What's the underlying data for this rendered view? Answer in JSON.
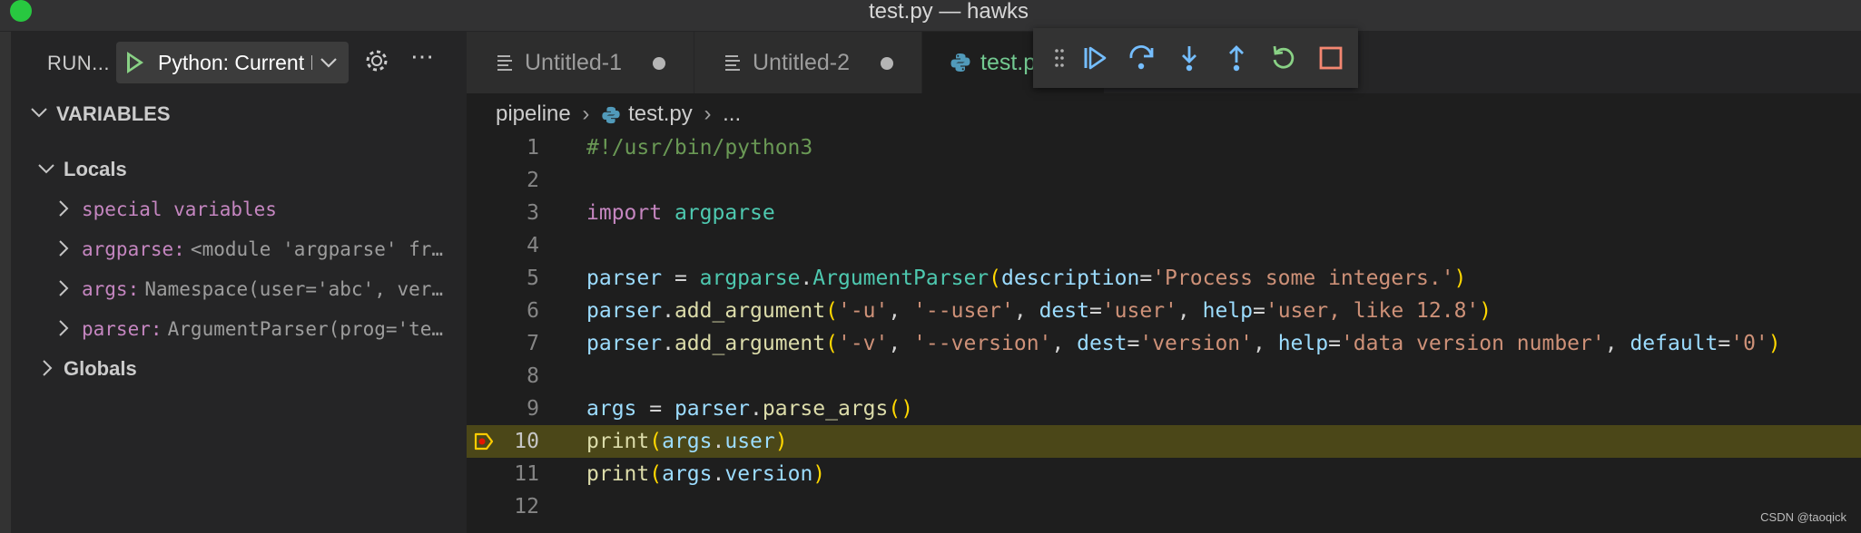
{
  "window": {
    "title": "test.py — hawks"
  },
  "sidebar": {
    "run_label": "RUN...",
    "config_name": "Python: Current File",
    "variables_title": "VARIABLES",
    "locals_label": "Locals",
    "globals_label": "Globals",
    "variables": [
      {
        "name": "special variables",
        "value": ""
      },
      {
        "name": "argparse:",
        "value": "<module 'argparse' fr…"
      },
      {
        "name": "args:",
        "value": "Namespace(user='abc', ver…"
      },
      {
        "name": "parser:",
        "value": "ArgumentParser(prog='te…"
      }
    ]
  },
  "tabs": [
    {
      "label": "Untitled-1",
      "dirty": true
    },
    {
      "label": "Untitled-2",
      "dirty": true
    },
    {
      "label": "test.py",
      "active": true
    }
  ],
  "breadcrumb": {
    "folder": "pipeline",
    "file": "test.py",
    "more": "..."
  },
  "editor": {
    "current_line": 10,
    "line_numbers": [
      "1",
      "2",
      "3",
      "4",
      "5",
      "6",
      "7",
      "8",
      "9",
      "10",
      "11",
      "12"
    ]
  },
  "colors": {
    "accent_green": "#89d185",
    "debug_blue": "#75beff",
    "restart_green": "#89d185",
    "stop_red": "#f48771",
    "current_line_bg": "#4b4718",
    "breakpoint_yellow": "#ffcc00"
  },
  "watermark": "CSDN @taoqick"
}
